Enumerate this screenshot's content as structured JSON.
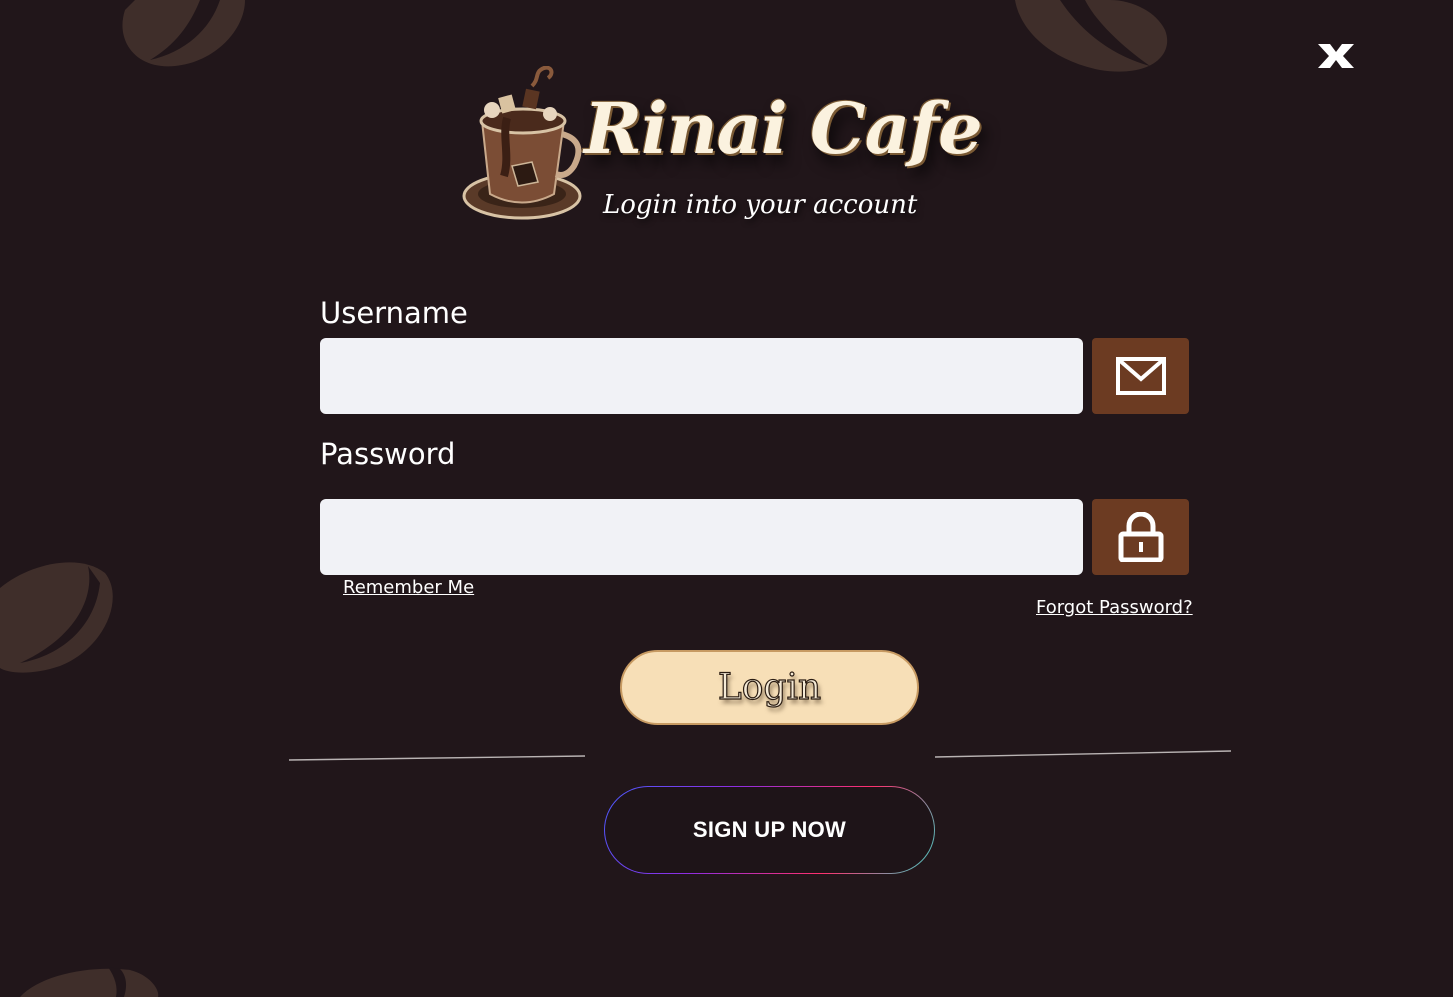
{
  "app": {
    "brand_name": "Rinai Cafe",
    "tagline": "Login into your account"
  },
  "form": {
    "username_label": "Username",
    "username_value": "",
    "password_label": "Password",
    "password_value": "",
    "remember_me": "Remember Me",
    "forgot_password": "Forgot Password?",
    "login_button": "Login",
    "signup_button": "SIGN UP NOW"
  },
  "icons": {
    "close": "close-x-icon",
    "username": "mail-icon",
    "password": "lock-icon",
    "logo": "coffee-cup-icon"
  },
  "colors": {
    "background": "#21161a",
    "field_background": "#f1f2f6",
    "icon_button": "#6c3b22",
    "login_button": "#f7dfb7",
    "bean": "#3f2e2a"
  }
}
